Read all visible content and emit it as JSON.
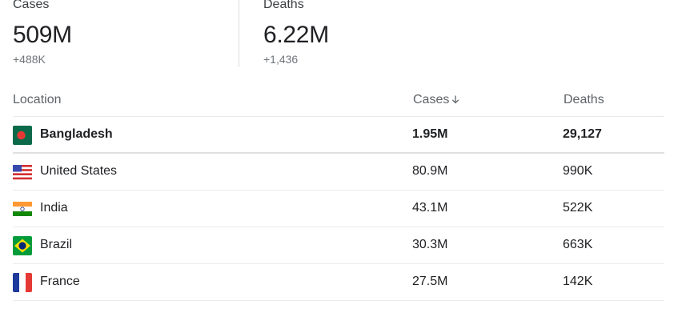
{
  "summary": {
    "cases": {
      "label": "Cases",
      "value": "509M",
      "delta": "+488K"
    },
    "deaths": {
      "label": "Deaths",
      "value": "6.22M",
      "delta": "+1,436"
    }
  },
  "table": {
    "headers": {
      "location": "Location",
      "cases": "Cases",
      "deaths": "Deaths"
    },
    "sort": {
      "column": "cases",
      "direction": "descending",
      "icon": "arrow-down-icon"
    },
    "rows": [
      {
        "location": "Bangladesh",
        "cases": "1.95M",
        "deaths": "29,127",
        "flag": "bangladesh-flag-icon",
        "selected": true
      },
      {
        "location": "United States",
        "cases": "80.9M",
        "deaths": "990K",
        "flag": "united-states-flag-icon",
        "selected": false
      },
      {
        "location": "India",
        "cases": "43.1M",
        "deaths": "522K",
        "flag": "india-flag-icon",
        "selected": false
      },
      {
        "location": "Brazil",
        "cases": "30.3M",
        "deaths": "663K",
        "flag": "brazil-flag-icon",
        "selected": false
      },
      {
        "location": "France",
        "cases": "27.5M",
        "deaths": "142K",
        "flag": "france-flag-icon",
        "selected": false
      }
    ]
  },
  "colors": {
    "text_primary": "#202124",
    "text_secondary": "#5f6368",
    "divider": "#e8eaed"
  }
}
